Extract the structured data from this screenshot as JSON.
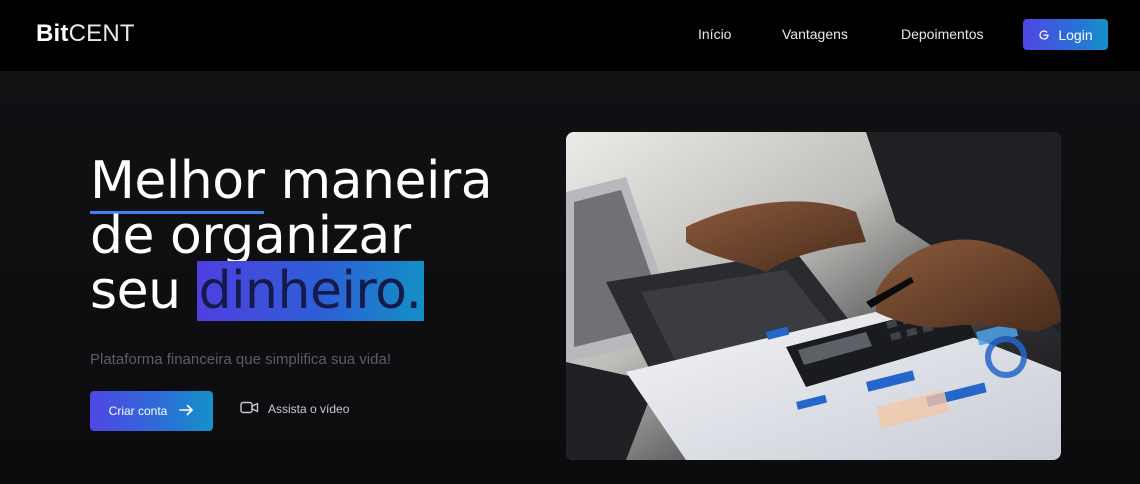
{
  "header": {
    "logo_bold": "Bit",
    "logo_light": "CENT",
    "nav": [
      "Início",
      "Vantagens",
      "Depoimentos"
    ],
    "login_label": "Login",
    "login_icon": "google-icon"
  },
  "hero": {
    "headline": {
      "line1_underlined": "Melhor",
      "line1_rest": " maneira",
      "line2": "de organizar",
      "line3_plain": "seu ",
      "line3_highlight": "dinheiro."
    },
    "subtitle": "Plataforma financeira que simplifica sua vida!",
    "cta_label": "Criar conta",
    "cta_icon": "arrow-right-icon",
    "video_label": "Assista o vídeo",
    "video_icon": "video-camera-icon",
    "image_subject": "hands using calculator and laptop over financial charts"
  },
  "colors": {
    "accent_start": "#4f46e5",
    "accent_end": "#1591c9",
    "background": "#0e0e10",
    "header_bg": "#000000"
  }
}
